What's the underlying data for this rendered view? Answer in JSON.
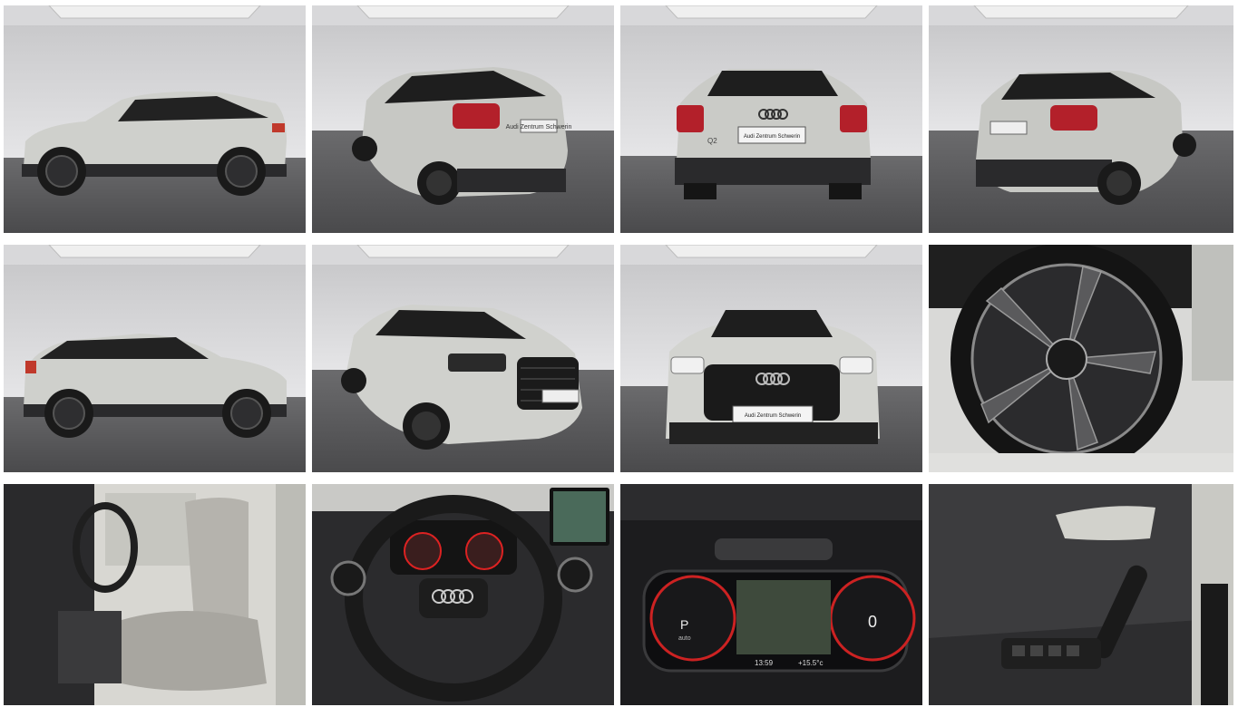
{
  "gallery": {
    "photos": [
      {
        "name": "exterior-side-left"
      },
      {
        "name": "exterior-rear-three-quarter-left"
      },
      {
        "name": "exterior-rear"
      },
      {
        "name": "exterior-rear-three-quarter-right"
      },
      {
        "name": "exterior-side-right"
      },
      {
        "name": "exterior-front-three-quarter"
      },
      {
        "name": "exterior-front"
      },
      {
        "name": "wheel-closeup"
      },
      {
        "name": "interior-front-seats"
      },
      {
        "name": "interior-steering-wheel"
      },
      {
        "name": "interior-virtual-cockpit"
      },
      {
        "name": "interior-door-panel"
      }
    ],
    "plates": {
      "rear": "Audi Zentrum Schwerin",
      "front": "Audi Zentrum Schwerin"
    },
    "badges": {
      "model": "Q2"
    },
    "cockpit": {
      "gear": "P",
      "gear_mode": "auto",
      "time": "13:59",
      "temperature": "+15.5°c",
      "speed": "0"
    }
  }
}
